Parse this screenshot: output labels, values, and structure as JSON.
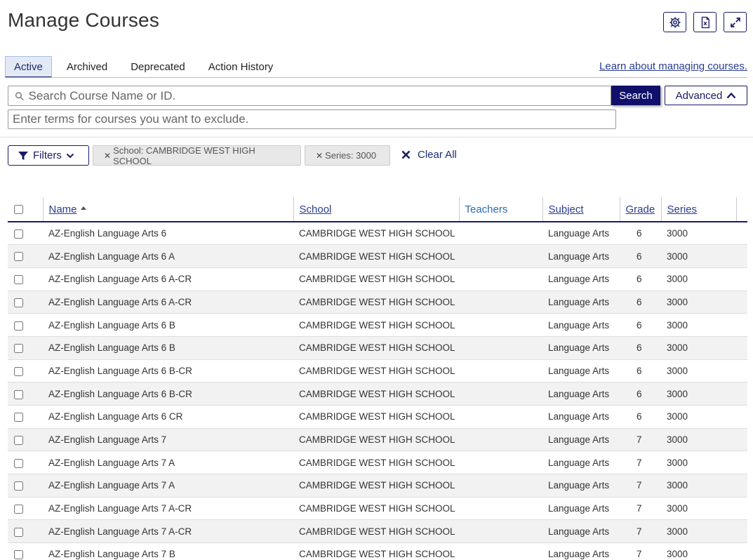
{
  "page": {
    "title": "Manage Courses"
  },
  "toolbar": {
    "icons": [
      "gear-icon",
      "excel-export-icon",
      "expand-icon"
    ]
  },
  "tabs": [
    {
      "label": "Active",
      "active": true
    },
    {
      "label": "Archived",
      "active": false
    },
    {
      "label": "Deprecated",
      "active": false
    },
    {
      "label": "Action History",
      "active": false
    }
  ],
  "help_link": "Learn about managing courses.",
  "search": {
    "placeholder": "Search Course Name or ID.",
    "button_label": "Search",
    "advanced_label": "Advanced",
    "exclude_placeholder": "Enter terms for courses you want to exclude."
  },
  "filters": {
    "button_label": "Filters",
    "chips": [
      {
        "label": "School: CAMBRIDGE WEST HIGH SCHOOL"
      },
      {
        "label": "Series: 3000"
      }
    ],
    "clear_all_label": "Clear All"
  },
  "table": {
    "columns": {
      "name": "Name",
      "school": "School",
      "teachers": "Teachers",
      "subject": "Subject",
      "grade": "Grade",
      "series": "Series"
    },
    "rows": [
      {
        "name": "AZ-English Language Arts 6",
        "school": "CAMBRIDGE WEST HIGH SCHOOL",
        "teachers": "",
        "subject": "Language Arts",
        "grade": "6",
        "series": "3000"
      },
      {
        "name": "AZ-English Language Arts 6 A",
        "school": "CAMBRIDGE WEST HIGH SCHOOL",
        "teachers": "",
        "subject": "Language Arts",
        "grade": "6",
        "series": "3000"
      },
      {
        "name": "AZ-English Language Arts 6 A-CR",
        "school": "CAMBRIDGE WEST HIGH SCHOOL",
        "teachers": "",
        "subject": "Language Arts",
        "grade": "6",
        "series": "3000"
      },
      {
        "name": "AZ-English Language Arts 6 A-CR",
        "school": "CAMBRIDGE WEST HIGH SCHOOL",
        "teachers": "",
        "subject": "Language Arts",
        "grade": "6",
        "series": "3000"
      },
      {
        "name": "AZ-English Language Arts 6 B",
        "school": "CAMBRIDGE WEST HIGH SCHOOL",
        "teachers": "",
        "subject": "Language Arts",
        "grade": "6",
        "series": "3000"
      },
      {
        "name": "AZ-English Language Arts 6 B",
        "school": "CAMBRIDGE WEST HIGH SCHOOL",
        "teachers": "",
        "subject": "Language Arts",
        "grade": "6",
        "series": "3000"
      },
      {
        "name": "AZ-English Language Arts 6 B-CR",
        "school": "CAMBRIDGE WEST HIGH SCHOOL",
        "teachers": "",
        "subject": "Language Arts",
        "grade": "6",
        "series": "3000"
      },
      {
        "name": "AZ-English Language Arts 6 B-CR",
        "school": "CAMBRIDGE WEST HIGH SCHOOL",
        "teachers": "",
        "subject": "Language Arts",
        "grade": "6",
        "series": "3000"
      },
      {
        "name": "AZ-English Language Arts 6 CR",
        "school": "CAMBRIDGE WEST HIGH SCHOOL",
        "teachers": "",
        "subject": "Language Arts",
        "grade": "6",
        "series": "3000"
      },
      {
        "name": "AZ-English Language Arts 7",
        "school": "CAMBRIDGE WEST HIGH SCHOOL",
        "teachers": "",
        "subject": "Language Arts",
        "grade": "7",
        "series": "3000"
      },
      {
        "name": "AZ-English Language Arts 7 A",
        "school": "CAMBRIDGE WEST HIGH SCHOOL",
        "teachers": "",
        "subject": "Language Arts",
        "grade": "7",
        "series": "3000"
      },
      {
        "name": "AZ-English Language Arts 7 A",
        "school": "CAMBRIDGE WEST HIGH SCHOOL",
        "teachers": "",
        "subject": "Language Arts",
        "grade": "7",
        "series": "3000"
      },
      {
        "name": "AZ-English Language Arts 7 A-CR",
        "school": "CAMBRIDGE WEST HIGH SCHOOL",
        "teachers": "",
        "subject": "Language Arts",
        "grade": "7",
        "series": "3000"
      },
      {
        "name": "AZ-English Language Arts 7 A-CR",
        "school": "CAMBRIDGE WEST HIGH SCHOOL",
        "teachers": "",
        "subject": "Language Arts",
        "grade": "7",
        "series": "3000"
      },
      {
        "name": "AZ-English Language Arts 7 B",
        "school": "CAMBRIDGE WEST HIGH SCHOOL",
        "teachers": "",
        "subject": "Language Arts",
        "grade": "7",
        "series": "3000"
      }
    ]
  },
  "colors": {
    "primary": "#10106a",
    "link": "#2a3d8f",
    "active_tab_bg": "#e3e9f5",
    "row_stripe": "#f2f2f2"
  }
}
